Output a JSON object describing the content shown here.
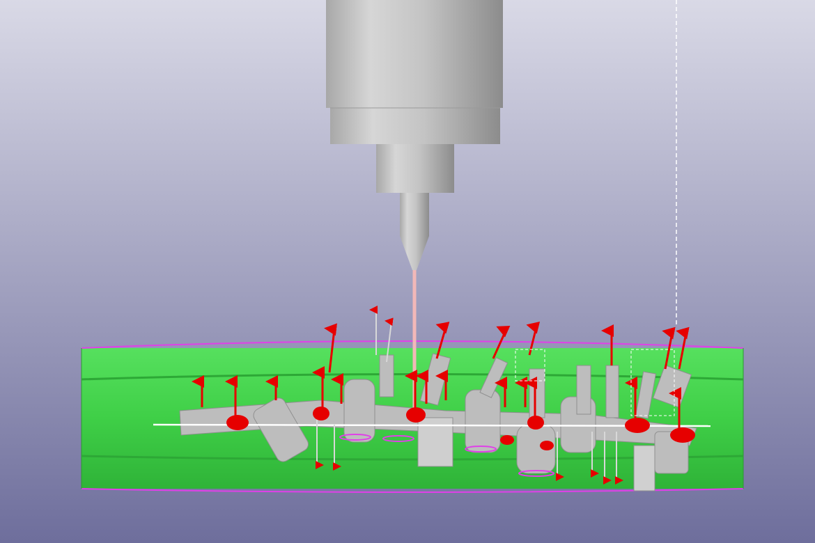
{
  "scene": {
    "background_top": "#d9d9e6",
    "background_bottom": "#6e6e9c",
    "stock_color": "#3fcf47",
    "stock_edge_color": "#e040e8",
    "tool_color": "#c8c8c8",
    "toolpath_color": "#f2b8b8",
    "arrow_color": "#e60000",
    "part_color": "#bdbdbd"
  }
}
